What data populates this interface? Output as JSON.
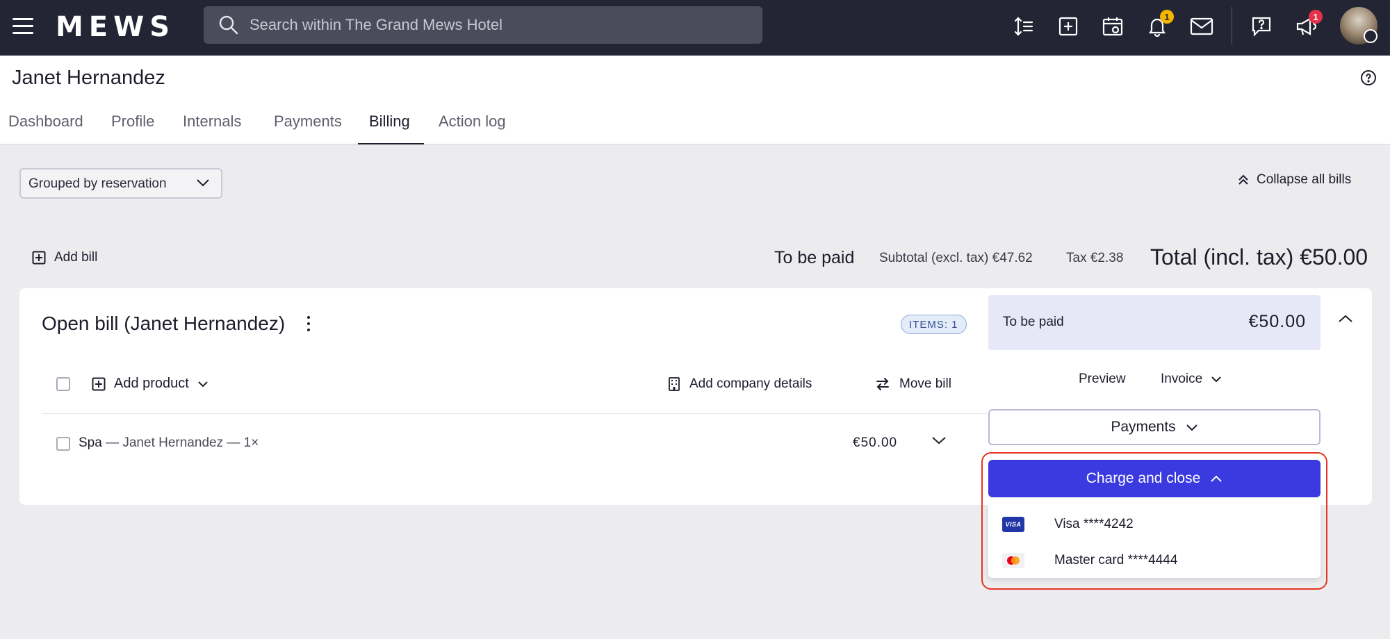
{
  "topbar": {
    "logo": "MEWS",
    "search_placeholder": "Search within The Grand Mews Hotel",
    "notifications_badge": "1",
    "announcements_badge": "1",
    "icons": [
      "menu-icon",
      "search-icon",
      "sort-icon",
      "add-icon",
      "calendar-icon",
      "bell-icon",
      "mail-icon",
      "help-chat-icon",
      "megaphone-icon"
    ]
  },
  "header": {
    "guest_name": "Janet Hernandez",
    "tabs": [
      "Dashboard",
      "Profile",
      "Internals",
      "Payments",
      "Billing",
      "Action log"
    ],
    "active_tab": "Billing"
  },
  "controls": {
    "group_select_value": "Grouped by reservation",
    "collapse_all_label": "Collapse all bills",
    "add_bill_label": "Add bill"
  },
  "summary": {
    "to_be_paid_label": "To be paid",
    "subtotal": "Subtotal (excl. tax) €47.62",
    "tax": "Tax €2.38",
    "total": "Total (incl. tax) €50.00"
  },
  "bill": {
    "title": "Open bill (Janet Hernandez)",
    "items_badge": "ITEMS: 1",
    "add_product_label": "Add product",
    "add_company_label": "Add company details",
    "move_bill_label": "Move bill",
    "items": [
      {
        "name": "Spa",
        "detail": " — Janet Hernandez — 1×",
        "price": "€50.00"
      }
    ]
  },
  "panel": {
    "to_be_paid_label": "To be paid",
    "to_be_paid_amount": "€50.00",
    "preview_label": "Preview",
    "invoice_label": "Invoice",
    "payments_label": "Payments",
    "charge_label": "Charge and close",
    "cards": [
      {
        "label": "Visa ****4242",
        "brand": "VISA",
        "icon": "visa-card-icon"
      },
      {
        "label": "Master card ****4444",
        "icon": "mastercard-icon"
      }
    ]
  },
  "colors": {
    "topbar": "#242534",
    "primary_button": "#3a3ae0",
    "highlight": "#e53422"
  }
}
